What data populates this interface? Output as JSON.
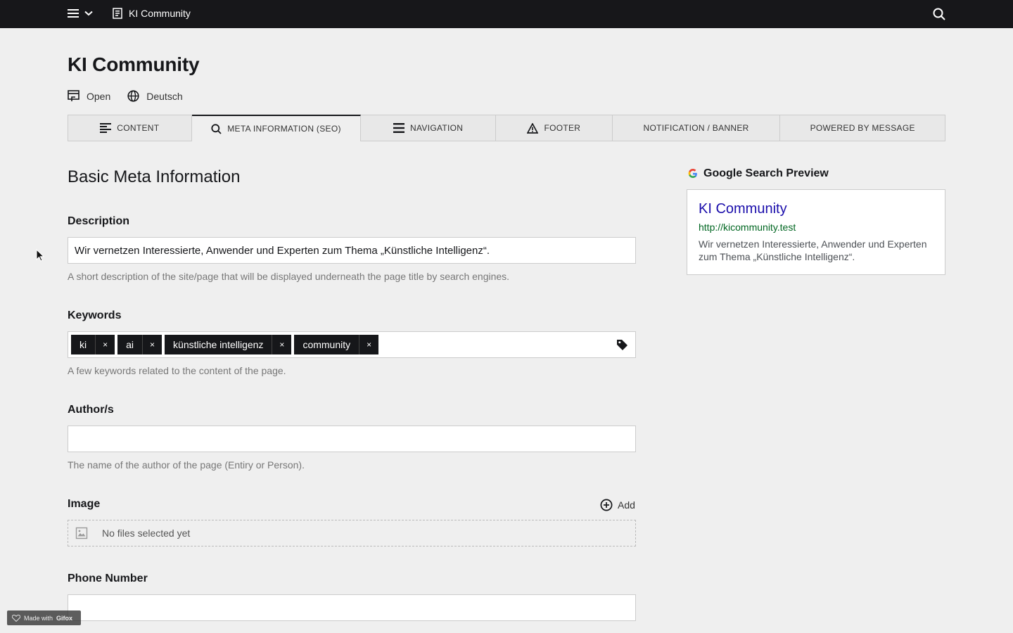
{
  "topbar": {
    "site_name": "KI Community"
  },
  "page": {
    "title": "KI Community",
    "open_label": "Open",
    "language_label": "Deutsch"
  },
  "tabs": [
    {
      "label": "CONTENT"
    },
    {
      "label": "META INFORMATION (SEO)"
    },
    {
      "label": "NAVIGATION"
    },
    {
      "label": "FOOTER"
    },
    {
      "label": "NOTIFICATION / BANNER"
    },
    {
      "label": "POWERED BY MESSAGE"
    }
  ],
  "form": {
    "section_title": "Basic Meta Information",
    "description": {
      "label": "Description",
      "value": "Wir vernetzen Interessierte, Anwender und Experten zum Thema „Künstliche Intelligenz“.",
      "help": "A short description of the site/page that will be displayed underneath the page title by search engines."
    },
    "keywords": {
      "label": "Keywords",
      "tags": [
        "ki",
        "ai",
        "künstliche intelligenz",
        "community"
      ],
      "remove_symbol": "×",
      "help": "A few keywords related to the content of the page."
    },
    "author": {
      "label": "Author/s",
      "value": "",
      "help": "The name of the author of the page (Entiry or Person)."
    },
    "image": {
      "label": "Image",
      "add_label": "Add",
      "empty_text": "No files selected yet"
    },
    "phone": {
      "label": "Phone Number",
      "value": ""
    }
  },
  "google_preview": {
    "title": "Google Search Preview",
    "result_title": "KI Community",
    "result_url": "http://kicommunity.test",
    "result_description": "Wir vernetzen Interessierte, Anwender und Experten zum Thema „Künstliche Intelligenz“."
  },
  "badge": {
    "text_prefix": "Made with",
    "text_brand": "Gifox"
  },
  "colors": {
    "topbar": "#17171a",
    "background": "#efefef",
    "link_blue": "#1a0dab",
    "url_green": "#006621"
  }
}
